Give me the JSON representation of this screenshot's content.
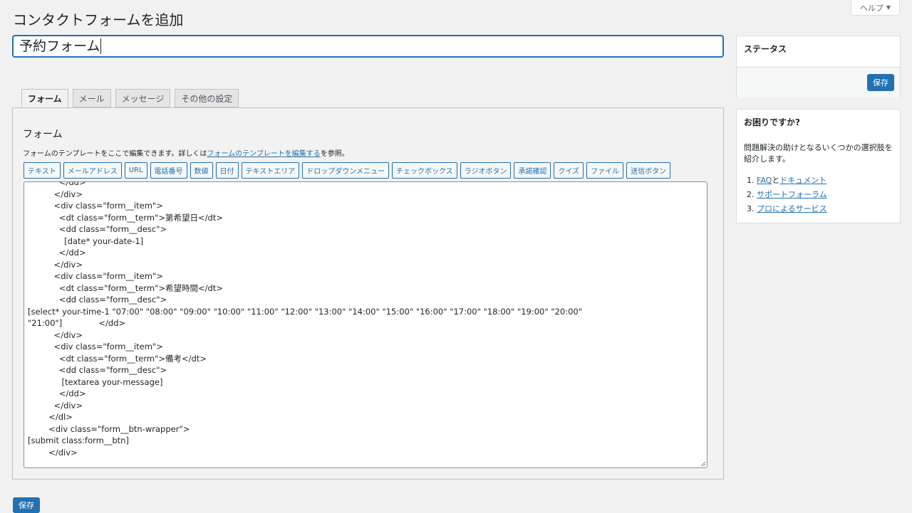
{
  "header": {
    "help_label": "ヘルプ",
    "page_title": "コンタクトフォームを追加"
  },
  "form_title": {
    "value": "予約フォーム"
  },
  "tabs": [
    {
      "label": "フォーム",
      "active": true
    },
    {
      "label": "メール"
    },
    {
      "label": "メッセージ"
    },
    {
      "label": "その他の設定"
    }
  ],
  "form_panel": {
    "heading": "フォーム",
    "desc_before": "フォームのテンプレートをここで編集できます。詳しくは",
    "desc_link": "フォームのテンプレートを編集する",
    "desc_after": "を参照。",
    "tag_buttons": [
      "テキスト",
      "メールアドレス",
      "URL",
      "電話番号",
      "数値",
      "日付",
      "テキストエリア",
      "ドロップダウンメニュー",
      "チェックボックス",
      "ラジオボタン",
      "承諾確認",
      "クイズ",
      "ファイル",
      "送信ボタン"
    ],
    "code_lines": [
      "            </dd>",
      "          </div>",
      "          <div class=\"form__item\">",
      "            <dt class=\"form__term\">第希望日</dt>",
      "            <dd class=\"form__desc\">",
      "              [date* your-date-1]",
      "            </dd>",
      "          </div>",
      "          <div class=\"form__item\">",
      "            <dt class=\"form__term\">希望時間</dt>",
      "            <dd class=\"form__desc\">",
      "[select* your-time-1 \"07:00\" \"08:00\" \"09:00\" \"10:00\" \"11:00\" \"12:00\" \"13:00\" \"14:00\" \"15:00\" \"16:00\" \"17:00\" \"18:00\" \"19:00\" \"20:00\"",
      "\"21:00\"]              </dd>",
      "          </div>",
      "          <div class=\"form__item\">",
      "            <dt class=\"form__term\">備考</dt>",
      "            <dd class=\"form__desc\">",
      "             [textarea your-message]",
      "            </dd>",
      "          </div>",
      "        </dl>",
      "        <div class=\"form__btn-wrapper\">",
      "[submit class:form__btn]",
      "        </div>"
    ]
  },
  "save_button_label": "保存",
  "status_box": {
    "title": "ステータス",
    "save_label": "保存"
  },
  "help_box": {
    "title": "お困りですか?",
    "text": "問題解決の助けとなるいくつかの選択肢を紹介します。",
    "items": [
      {
        "link1": "FAQ",
        "mid": "と",
        "link2": "ドキュメント"
      },
      {
        "link1": "サポートフォーラム"
      },
      {
        "link1": "プロによるサービス"
      }
    ]
  }
}
